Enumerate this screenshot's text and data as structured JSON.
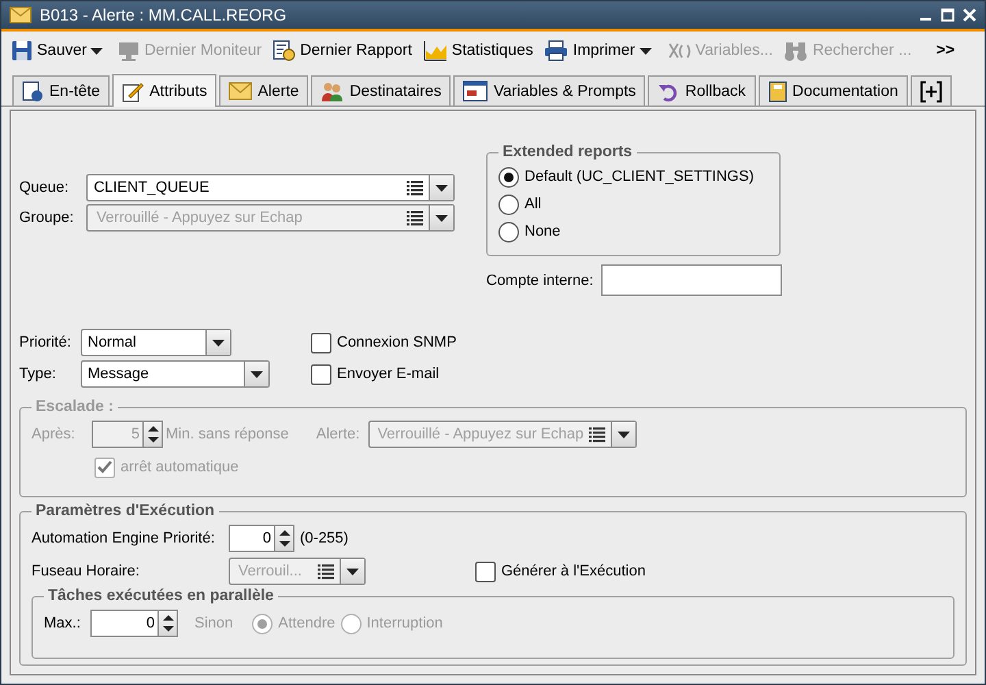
{
  "window": {
    "title": "B013 - Alerte : MM.CALL.REORG"
  },
  "toolbar": [
    {
      "label": "Sauver",
      "kind": "save",
      "disabled": false,
      "dropdown": true
    },
    {
      "label": "Dernier Moniteur",
      "kind": "monitor",
      "disabled": true,
      "dropdown": false
    },
    {
      "label": "Dernier Rapport",
      "kind": "report",
      "disabled": false,
      "dropdown": false
    },
    {
      "label": "Statistiques",
      "kind": "stats",
      "disabled": false,
      "dropdown": false
    },
    {
      "label": "Imprimer",
      "kind": "print",
      "disabled": false,
      "dropdown": true
    },
    {
      "label": "Variables...",
      "kind": "variables",
      "disabled": true,
      "dropdown": false
    },
    {
      "label": "Rechercher ...",
      "kind": "search",
      "disabled": true,
      "dropdown": false
    },
    {
      "label": ">>",
      "kind": "more",
      "disabled": false,
      "dropdown": false
    }
  ],
  "tabs": [
    {
      "label": "En-tête",
      "kind": "header",
      "selected": false
    },
    {
      "label": "Attributs",
      "kind": "attributes",
      "selected": true
    },
    {
      "label": "Alerte",
      "kind": "alert",
      "selected": false
    },
    {
      "label": "Destinataires",
      "kind": "recipients",
      "selected": false
    },
    {
      "label": "Variables & Prompts",
      "kind": "variables",
      "selected": false
    },
    {
      "label": "Rollback",
      "kind": "rollback",
      "selected": false
    },
    {
      "label": "Documentation",
      "kind": "docs",
      "selected": false
    },
    {
      "kind": "add",
      "selected": false
    }
  ],
  "queue": {
    "label": "Queue:",
    "value": "CLIENT_QUEUE",
    "disabled": false
  },
  "group": {
    "label": "Groupe:",
    "value": "Verrouillé - Appuyez sur Echap",
    "disabled": true
  },
  "extended_reports": {
    "title": "Extended reports",
    "options": [
      {
        "label": "Default (UC_CLIENT_SETTINGS)",
        "selected": true
      },
      {
        "label": "All",
        "selected": false
      },
      {
        "label": "None",
        "selected": false
      }
    ]
  },
  "internal_account": {
    "label": "Compte interne:"
  },
  "priority": {
    "label": "Priorité:",
    "value": "Normal"
  },
  "type": {
    "label": "Type:",
    "value": "Message"
  },
  "options": [
    {
      "label": "Connexion SNMP",
      "checked": false
    },
    {
      "label": "Envoyer E-mail",
      "checked": false
    }
  ],
  "escalation": {
    "title": "Escalade :",
    "disabled": true,
    "after_label": "Après:",
    "after_value": "5",
    "unit": "Min. sans réponse",
    "alert_label": "Alerte:",
    "alert_value": "Verrouillé - Appuyez sur Echap",
    "auto_stop": {
      "label": "arrêt automatique",
      "checked": true
    }
  },
  "execution": {
    "title": "Paramètres d'Exécution",
    "priority_label": "Automation Engine Priorité:",
    "priority_value": "0",
    "range": "(0-255)",
    "timezone_label": "Fuseau Horaire:",
    "timezone_value": "Verrouil...",
    "generate": {
      "label": "Générer à l'Exécution",
      "checked": false
    },
    "parallel": {
      "title": "Tâches exécutées en parallèle",
      "max_label": "Max.:",
      "max_value": "0",
      "otherwise": "Sinon",
      "disabled": true,
      "options": [
        {
          "label": "Attendre",
          "selected": true
        },
        {
          "label": "Interruption",
          "selected": false
        }
      ]
    }
  }
}
